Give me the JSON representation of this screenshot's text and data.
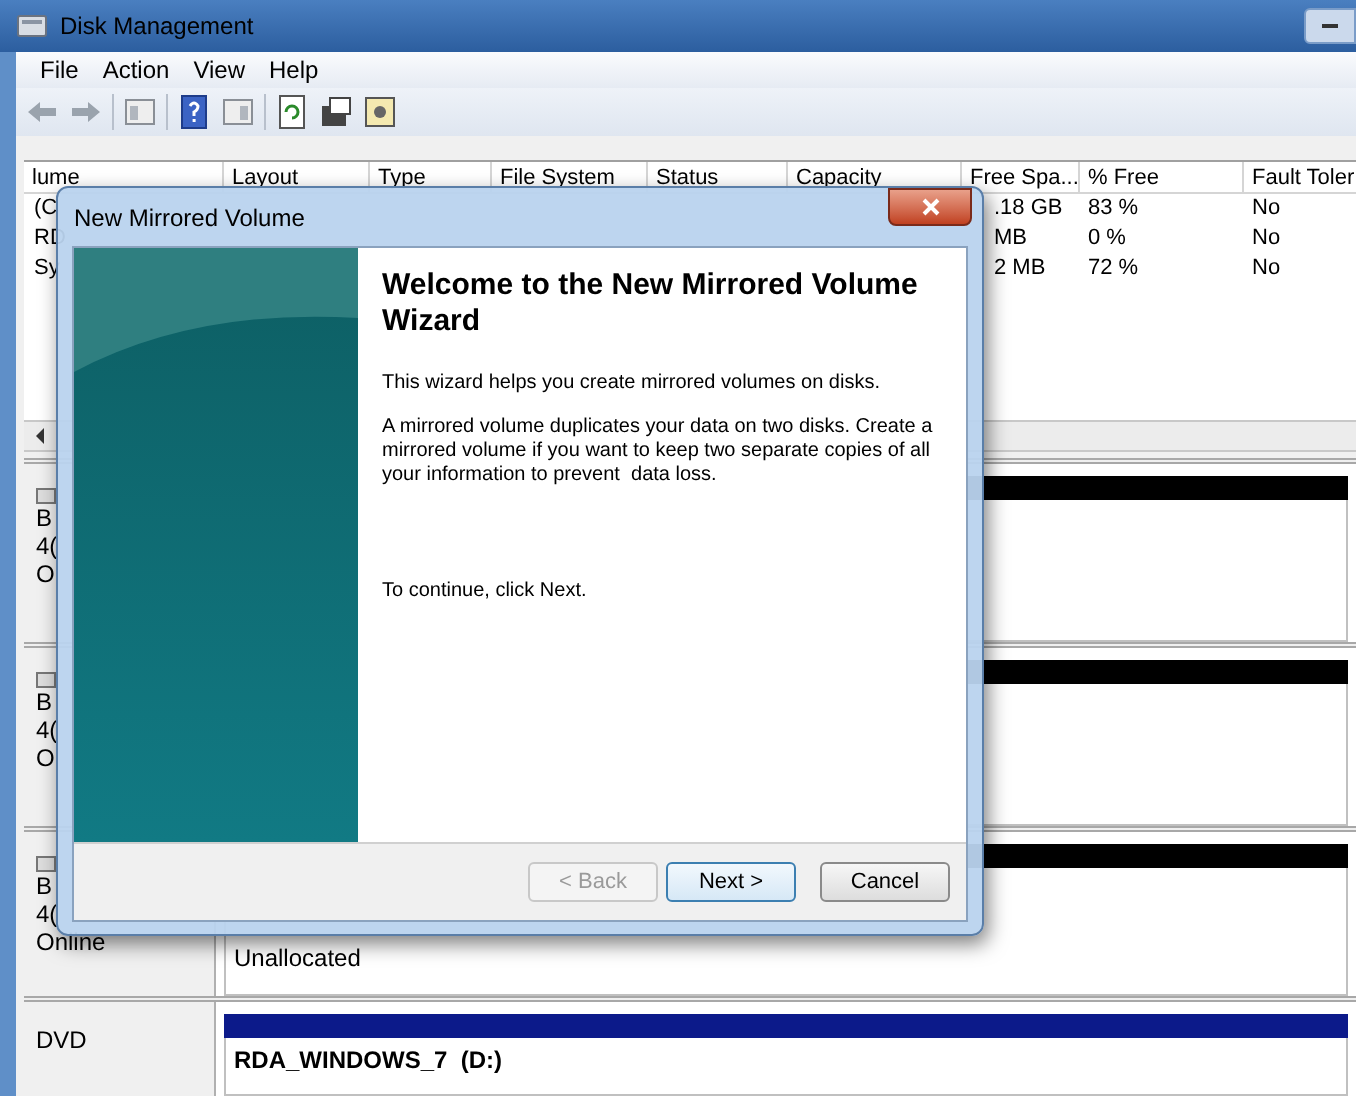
{
  "window": {
    "title": "Disk Management"
  },
  "menu": [
    "File",
    "Action",
    "View",
    "Help"
  ],
  "table": {
    "columns": [
      "lume",
      "Layout",
      "Type",
      "File System",
      "Status",
      "Capacity",
      "Free Spa...",
      "% Free",
      "Fault Toler"
    ],
    "rows": [
      {
        "volume": "(C",
        "free_space": ".18 GB",
        "percent_free": "83 %",
        "fault_tolerance": "No"
      },
      {
        "volume": "RD",
        "free_space": "MB",
        "percent_free": "0 %",
        "fault_tolerance": "No"
      },
      {
        "volume": "Sy",
        "free_space": "2 MB",
        "percent_free": "72 %",
        "fault_tolerance": "No"
      }
    ]
  },
  "disks": [
    {
      "lines": [
        "B",
        "4(",
        "O"
      ],
      "color": "#000000"
    },
    {
      "lines": [
        "B",
        "4(",
        "O"
      ],
      "color": "#000000"
    },
    {
      "lines": [
        "B",
        "4(",
        "Online"
      ],
      "color": "#000000",
      "volume": "Unallocated"
    },
    {
      "lines": [
        "DVD"
      ],
      "color": "#0c1a8a",
      "volume": "RDA_WINDOWS_7  (D:)"
    }
  ],
  "dialog": {
    "title": "New Mirrored Volume",
    "heading": "Welcome to the New Mirrored Volume Wizard",
    "paragraphs": [
      "This wizard helps you create mirrored volumes on disks.",
      "A mirrored volume duplicates your data on two disks. Create a mirrored volume if you want to keep two separate copies of all your information to prevent  data loss."
    ],
    "prompt": "To continue, click Next.",
    "buttons": [
      {
        "label": "< Back",
        "disabled": true,
        "default": false
      },
      {
        "label": "Next >",
        "disabled": false,
        "default": true
      },
      {
        "label": "Cancel",
        "disabled": false,
        "default": false
      }
    ]
  }
}
